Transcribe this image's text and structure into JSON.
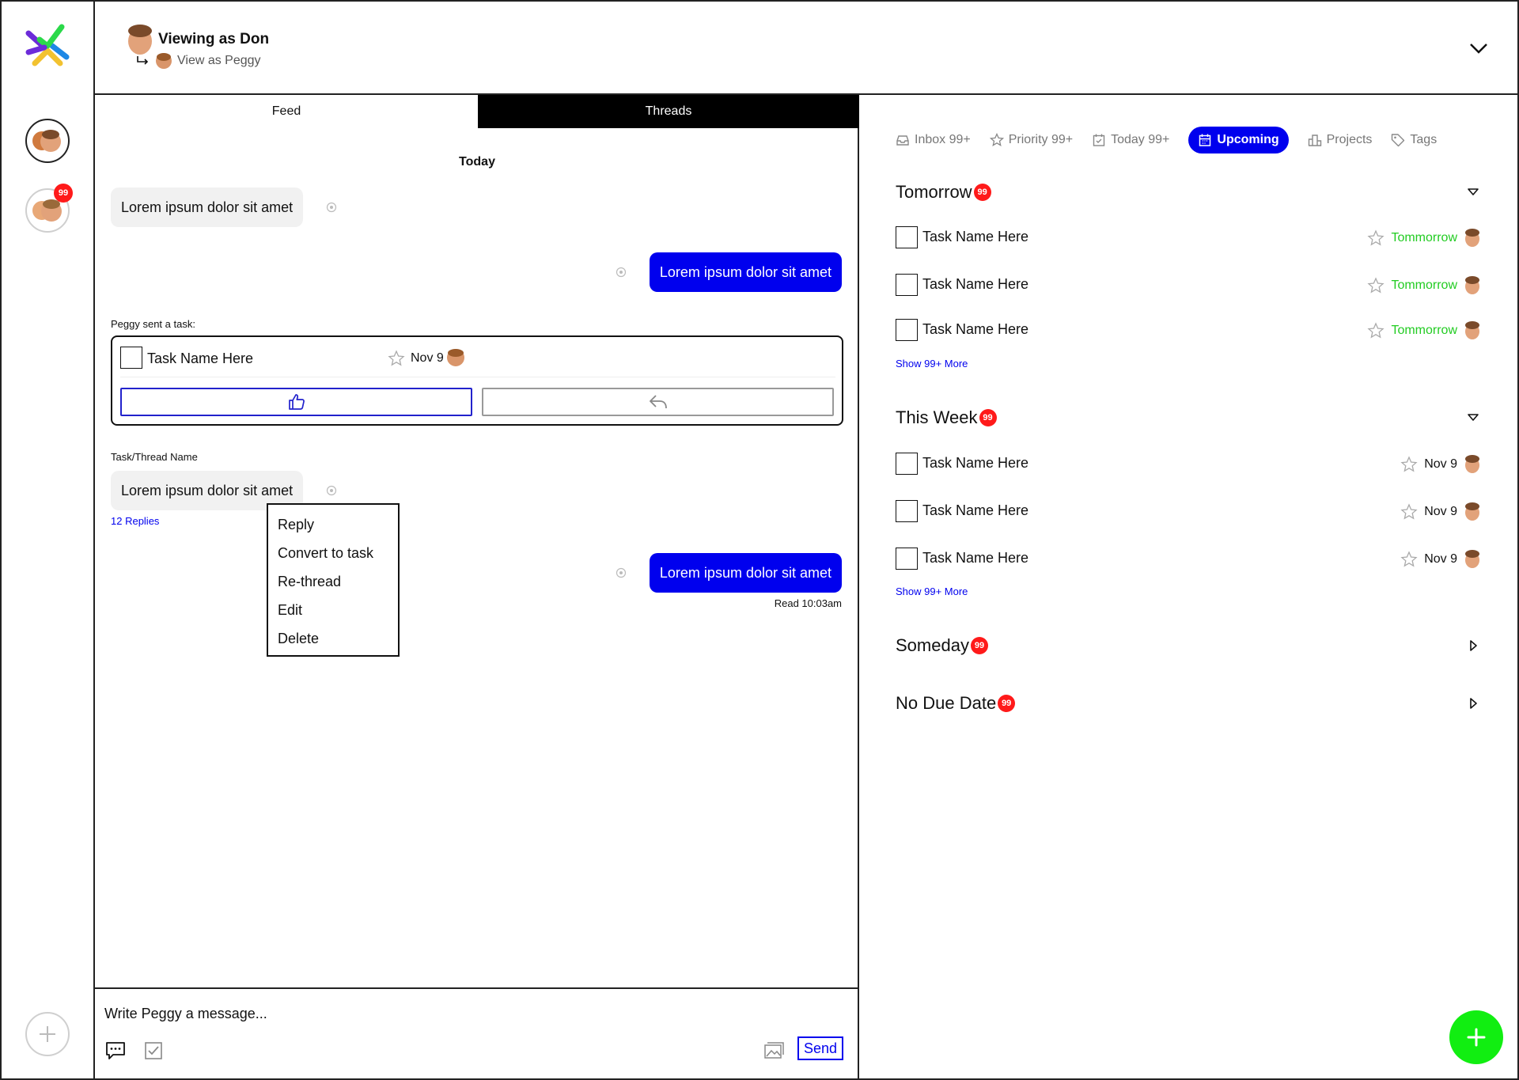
{
  "header": {
    "viewing_title": "Viewing as Don",
    "view_as_label": "View as Peggy"
  },
  "rail": {
    "unread_badge": "99"
  },
  "feed": {
    "tabs": [
      {
        "label": "Feed",
        "active": true
      },
      {
        "label": "Threads",
        "active": false
      }
    ],
    "day_label": "Today",
    "messages": [
      {
        "text": "Lorem ipsum dolor sit amet",
        "direction": "in"
      },
      {
        "text": "Lorem ipsum dolor sit amet",
        "direction": "out"
      },
      {
        "text": "Lorem ipsum dolor sit amet",
        "direction": "in"
      },
      {
        "text": "Lorem ipsum dolor sit amet",
        "direction": "out"
      }
    ],
    "task_share": {
      "label": "Peggy sent a task:",
      "task_name": "Task Name Here",
      "due": "Nov 9"
    },
    "thread": {
      "label": "Task/Thread Name",
      "replies": "12 Replies"
    },
    "read_receipt": "Read 10:03am",
    "context_menu": [
      "Reply",
      "Convert to task",
      "Re-thread",
      "Edit",
      "Delete"
    ],
    "composer": {
      "placeholder": "Write Peggy a message...",
      "send_label": "Send"
    }
  },
  "tasks": {
    "nav": [
      {
        "label": "Inbox 99+",
        "icon": "inbox-icon",
        "active": false
      },
      {
        "label": "Priority 99+",
        "icon": "star-icon",
        "active": false
      },
      {
        "label": "Today 99+",
        "icon": "calendar-check-icon",
        "active": false
      },
      {
        "label": "Upcoming",
        "icon": "calendar-icon",
        "active": true
      },
      {
        "label": "Projects",
        "icon": "projects-icon",
        "active": false
      },
      {
        "label": "Tags",
        "icon": "tag-icon",
        "active": false
      }
    ],
    "sections": [
      {
        "title": "Tomorrow",
        "badge": "99",
        "expanded": true,
        "tasks": [
          {
            "name": "Task Name Here",
            "due": "Tommorrow"
          },
          {
            "name": "Task Name Here",
            "due": "Tommorrow"
          },
          {
            "name": "Task Name Here",
            "due": "Tommorrow"
          }
        ],
        "show_more": "Show 99+ More"
      },
      {
        "title": "This Week",
        "badge": "99",
        "expanded": true,
        "tasks": [
          {
            "name": "Task Name Here",
            "due": "Nov 9"
          },
          {
            "name": "Task Name Here",
            "due": "Nov 9"
          },
          {
            "name": "Task Name Here",
            "due": "Nov 9"
          }
        ],
        "show_more": "Show 99+ More"
      },
      {
        "title": "Someday",
        "badge": "99",
        "expanded": false
      },
      {
        "title": "No Due Date",
        "badge": "99",
        "expanded": false
      }
    ]
  },
  "colors": {
    "accent": "#0000ee",
    "badge": "#ff1a1a",
    "success": "#22cc22",
    "fab": "#11ee11"
  }
}
